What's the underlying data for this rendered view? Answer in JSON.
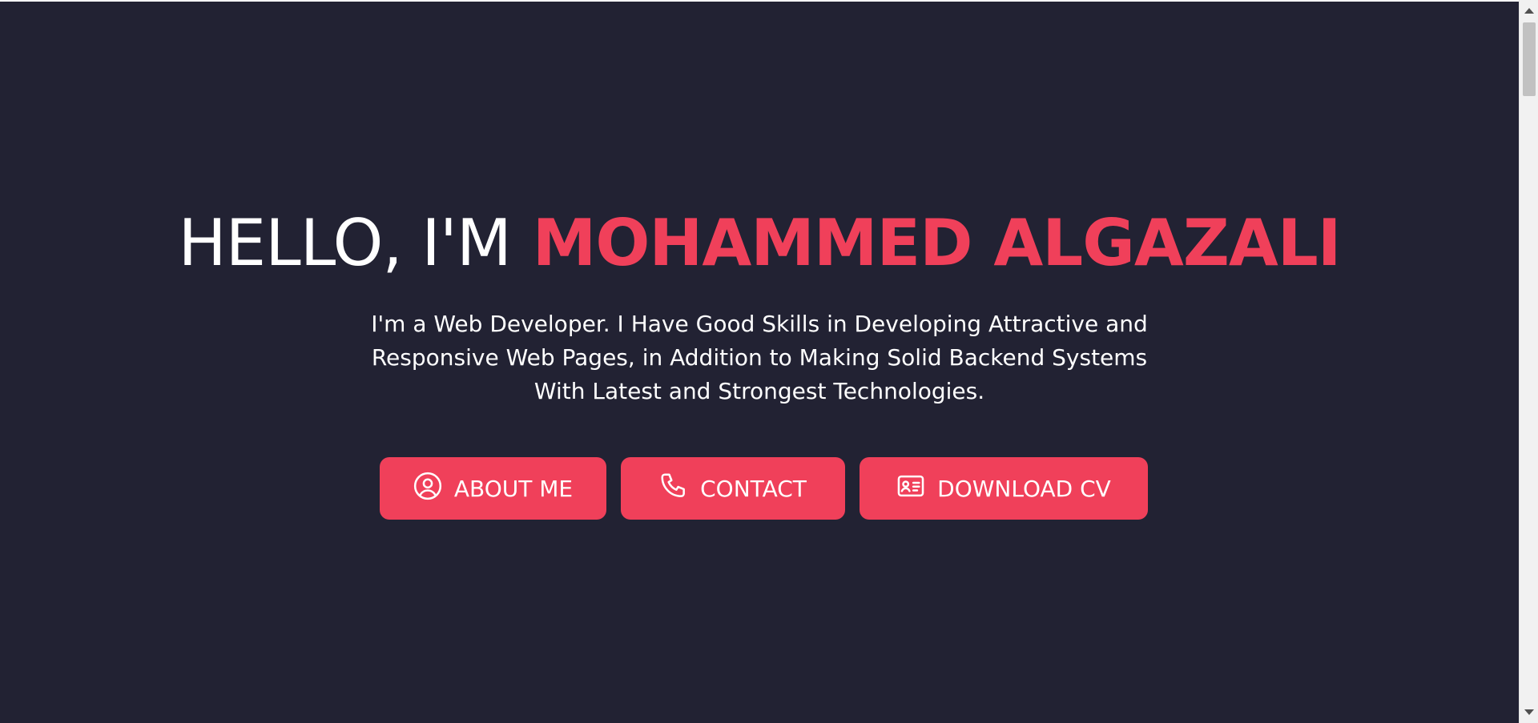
{
  "hero": {
    "greeting": "HELLO, I'M",
    "name": "MOHAMMED ALGAZALI",
    "description_lines": [
      "I'm a Web Developer. I Have Good Skills in Developing Attractive and",
      "Responsive Web Pages, in Addition to Making Solid Backend Systems",
      "With Latest and Strongest Technologies."
    ]
  },
  "buttons": {
    "about": {
      "label": "ABOUT ME",
      "icon": "user-circle-icon"
    },
    "contact": {
      "label": "CONTACT",
      "icon": "phone-icon"
    },
    "cv": {
      "label": "DOWNLOAD CV",
      "icon": "id-card-icon"
    }
  },
  "colors": {
    "background": "#222233",
    "accent": "#f0405a",
    "text": "#ffffff"
  }
}
